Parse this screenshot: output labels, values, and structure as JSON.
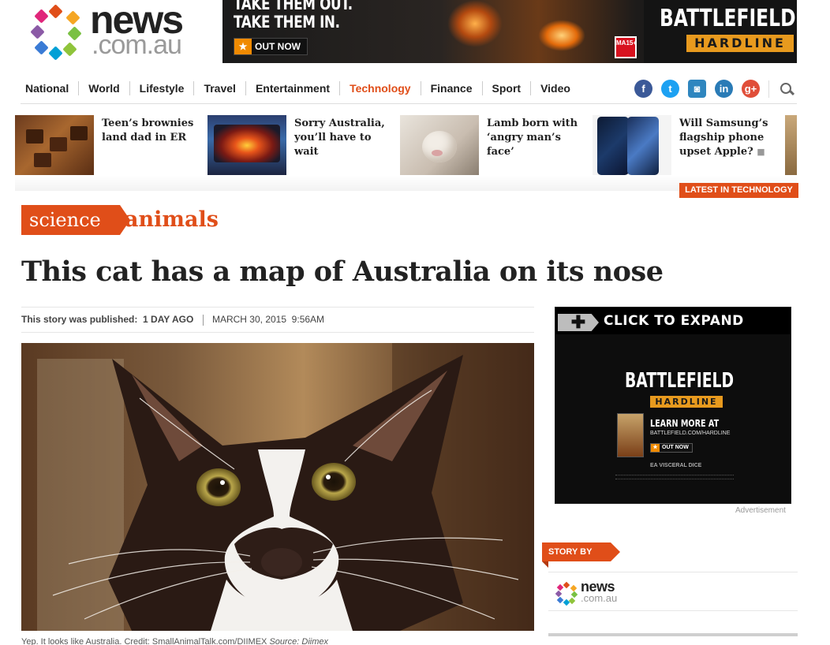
{
  "header": {
    "logo_text": "news",
    "logo_domain": ".com.au",
    "logo_colors": [
      "#e04e19",
      "#f5a623",
      "#7ac143",
      "#00a0d6",
      "#3a7bd5",
      "#8b5aa6",
      "#e0267a",
      "#d6004a"
    ]
  },
  "banner_ad": {
    "line1": "TAKE THEM OUT.",
    "line2": "TAKE THEM IN.",
    "cta": "OUT NOW",
    "rating": "MA15+",
    "brand_line1": "BATTLEFIELD",
    "brand_line2": "HARDLINE"
  },
  "nav": {
    "items": [
      {
        "label": "National"
      },
      {
        "label": "World"
      },
      {
        "label": "Lifestyle"
      },
      {
        "label": "Travel"
      },
      {
        "label": "Entertainment"
      },
      {
        "label": "Technology"
      },
      {
        "label": "Finance"
      },
      {
        "label": "Sport"
      },
      {
        "label": "Video"
      }
    ],
    "active": "Technology",
    "social": [
      {
        "name": "facebook",
        "glyph": "f",
        "color": "#3b5998"
      },
      {
        "name": "twitter",
        "glyph": "t",
        "color": "#1da1f2"
      },
      {
        "name": "instagram",
        "glyph": "◙",
        "color": "#2f86bf"
      },
      {
        "name": "linkedin",
        "glyph": "in",
        "color": "#2a7bb6"
      },
      {
        "name": "googleplus",
        "glyph": "g+",
        "color": "#e04e39"
      }
    ]
  },
  "latest": {
    "label": "LATEST IN TECHNOLOGY",
    "stories": [
      {
        "title": "Teen’s brownies land dad in ER"
      },
      {
        "title": "Sorry Australia, you’ll have to wait"
      },
      {
        "title": "Lamb born with ‘angry man’s face’"
      },
      {
        "title": "Will Samsung’s flagship phone upset Apple?"
      }
    ]
  },
  "article": {
    "section": "science",
    "subsection": "animals",
    "headline": "This cat has a map of Australia on its nose",
    "published_label": "This story was published:",
    "published_relative": "1 DAY AGO",
    "published_date": "MARCH 30, 2015  9:56AM",
    "caption": "Yep. It looks like Australia. Credit: SmallAnimalTalk.com/DIIMEX",
    "caption_source_label": "Source:",
    "caption_source": "Diimex"
  },
  "side_ad": {
    "expand": "CLICK TO EXPAND",
    "brand_line1": "BATTLEFIELD",
    "brand_line2": "HARDLINE",
    "learn_more": "LEARN MORE AT",
    "url": "BATTLEFIELD.COM/HARDLINE",
    "cta": "OUT NOW",
    "logos": "EA  VISCERAL  DICE",
    "label": "Advertisement"
  },
  "story_by": {
    "label": "STORY BY",
    "brand": "news",
    "domain": ".com.au"
  }
}
